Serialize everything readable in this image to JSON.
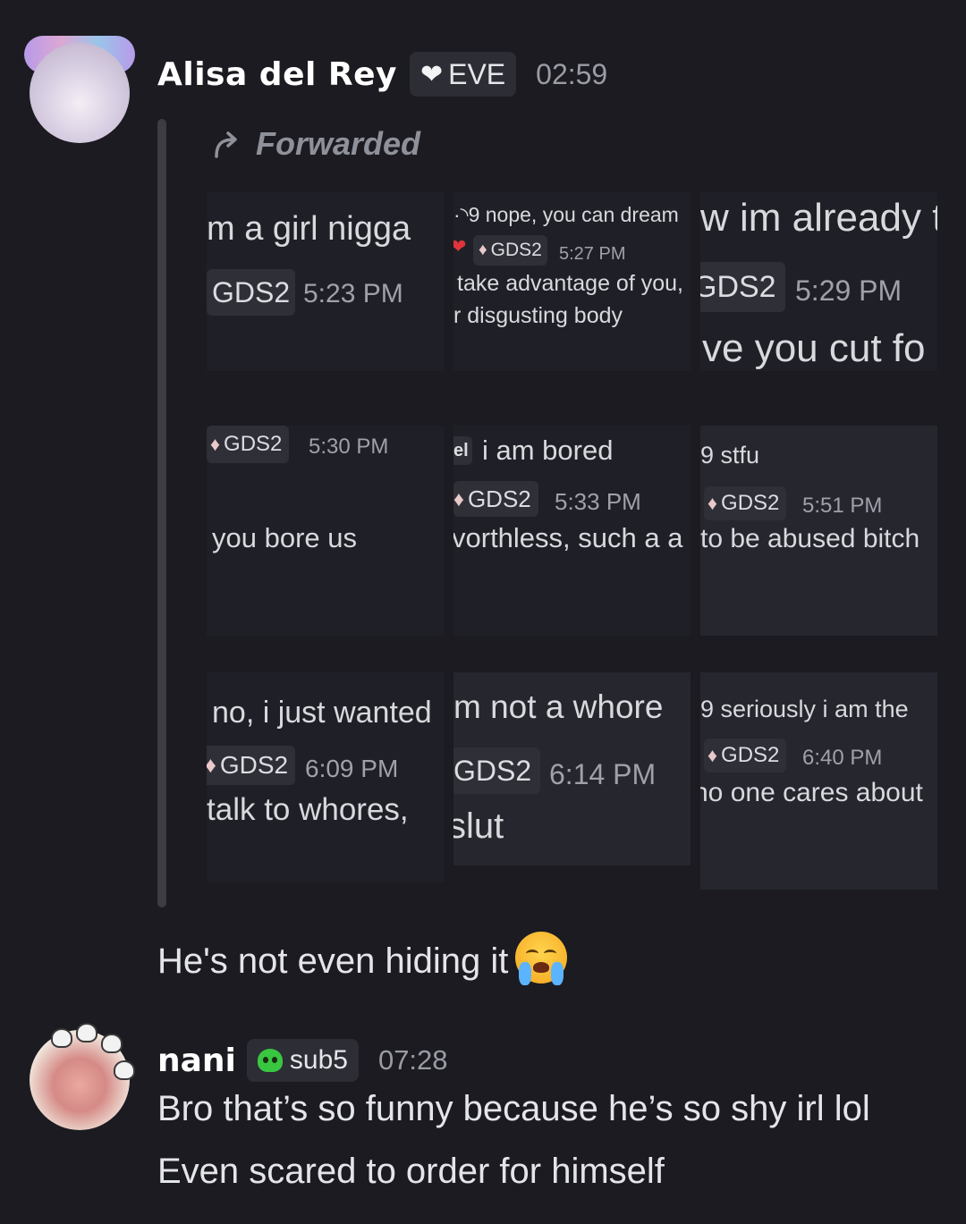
{
  "message1": {
    "username": "Alisa del Rey",
    "tag_icon": "heart-icon",
    "tag": "EVE",
    "time": "02:59",
    "forwarded_label": "Forwarded",
    "body": "He's not even hiding it",
    "emoji": "loudly-crying-face"
  },
  "screenshots": {
    "p1": {
      "line1": "m a girl nigga",
      "chip": "GDS2",
      "ts": "5:23 PM"
    },
    "p2": {
      "line1": "·◝9 nope, you can dream",
      "chip": "GDS2",
      "ts": "5:27 PM",
      "line2": "take advantage of you,",
      "line3": "r disgusting body"
    },
    "p3": {
      "line1": "w im already t",
      "chip": "GDS2",
      "ts": "5:29 PM",
      "line2": "ve you cut fo"
    },
    "p4": {
      "chip": "GDS2",
      "ts": "5:30 PM",
      "line1": "you bore us"
    },
    "p5": {
      "prefix": "el",
      "line1": "i am bored",
      "chip": "GDS2",
      "ts": "5:33 PM",
      "line2": "vorthless, such a a"
    },
    "p6": {
      "line1": "9  stfu",
      "chip": "GDS2",
      "ts": "5:51 PM",
      "line2": "to be abused bitch"
    },
    "p7": {
      "line1": "no, i just wanted",
      "chip": "GDS2",
      "ts": "6:09 PM",
      "line2": "talk to whores,"
    },
    "p8": {
      "line1": "m not a whore",
      "chip": "GDS2",
      "ts": "6:14 PM",
      "line2": "slut"
    },
    "p9": {
      "line1": "9  seriously i am the",
      "chip": "GDS2",
      "ts": "6:40 PM",
      "line2": "no one cares about"
    }
  },
  "message2": {
    "username": "nani",
    "tag_icon": "skull-icon",
    "tag": "sub5",
    "time": "07:28",
    "line1": "Bro that’s so funny because he’s so shy irl lol",
    "line2": "Even scared to order for himself"
  }
}
